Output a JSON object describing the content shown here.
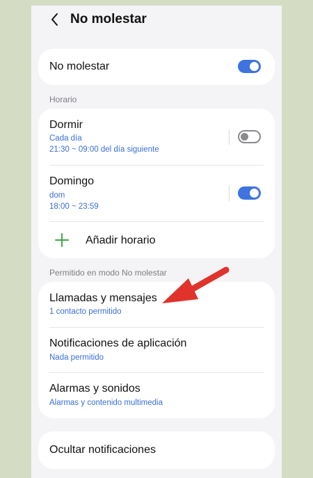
{
  "header": {
    "title": "No molestar"
  },
  "master": {
    "label": "No molestar",
    "enabled": true
  },
  "schedule": {
    "section_label": "Horario",
    "items": [
      {
        "title": "Dormir",
        "days": "Cada día",
        "time": "21:30 ~ 09:00 del día siguiente",
        "enabled": false
      },
      {
        "title": "Domingo",
        "days": "dom",
        "time": "18:00 ~ 23:59",
        "enabled": true
      }
    ],
    "add_label": "Añadir horario"
  },
  "allowed": {
    "section_label": "Permitido en modo No molestar",
    "items": [
      {
        "title": "Llamadas y mensajes",
        "subtitle": "1 contacto permitido"
      },
      {
        "title": "Notificaciones de aplicación",
        "subtitle": "Nada permitido"
      },
      {
        "title": "Alarmas y sonidos",
        "subtitle": "Alarmas y contenido multimedia"
      }
    ]
  },
  "hide": {
    "label": "Ocultar notificaciones"
  },
  "colors": {
    "accent": "#3e73e0",
    "link": "#3a6fd6",
    "plus": "#3fa64b",
    "annotation_arrow": "#e0332b"
  },
  "icons": {
    "back": "chevron-left-icon",
    "add": "plus-icon",
    "annotation": "red-arrow"
  }
}
